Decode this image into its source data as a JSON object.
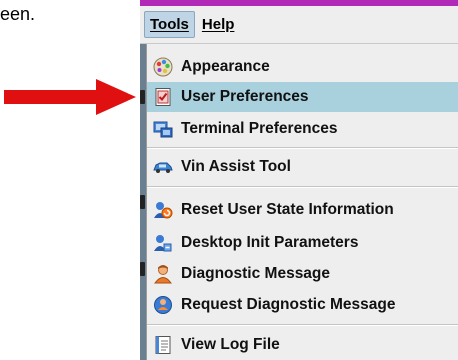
{
  "document": {
    "fragment_text": "een."
  },
  "menubar": {
    "items": [
      {
        "label": "Tools"
      },
      {
        "label": "Help"
      }
    ]
  },
  "tools_menu": {
    "items": [
      {
        "label": "Appearance",
        "icon": "palette-icon"
      },
      {
        "label": "User Preferences",
        "icon": "checklist-icon",
        "selected": true
      },
      {
        "label": "Terminal Preferences",
        "icon": "terminal-icon"
      },
      {
        "label": "Vin Assist Tool",
        "icon": "car-icon"
      },
      {
        "label": "Reset User State Information",
        "icon": "reset-icon"
      },
      {
        "label": "Desktop Init Parameters",
        "icon": "desktop-init-icon"
      },
      {
        "label": "Diagnostic Message",
        "icon": "user-icon"
      },
      {
        "label": "Request Diagnostic Message",
        "icon": "request-icon"
      },
      {
        "label": "View Log File",
        "icon": "log-file-icon"
      }
    ]
  },
  "colors": {
    "arrow": "#e01010",
    "selection": "#a8d1dd",
    "menu_background": "#eeeeee",
    "window_strip": "#b02ab7"
  }
}
